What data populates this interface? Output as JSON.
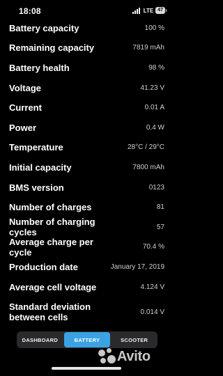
{
  "status_bar": {
    "time": "18:08",
    "network": "LTE",
    "battery_level": "47"
  },
  "rows": [
    {
      "label": "Battery capacity",
      "value": "100 %"
    },
    {
      "label": "Remaining capacity",
      "value": "7819 mAh"
    },
    {
      "label": "Battery health",
      "value": "98 %"
    },
    {
      "label": "Voltage",
      "value": "41.23 V"
    },
    {
      "label": "Current",
      "value": "0.01 A"
    },
    {
      "label": "Power",
      "value": "0.4 W"
    },
    {
      "label": "Temperature",
      "value": "28°C / 29°C"
    },
    {
      "label": "Initial capacity",
      "value": "7800 mAh"
    },
    {
      "label": "BMS version",
      "value": "0123"
    },
    {
      "label": "Number of charges",
      "value": "81"
    },
    {
      "label": "Number of charging cycles",
      "value": "57"
    },
    {
      "label": "Average charge per cycle",
      "value": "70.4 %"
    },
    {
      "label": "Production date",
      "value": "January 17, 2019"
    },
    {
      "label": "Average cell voltage",
      "value": "4.124 V"
    },
    {
      "label": "Standard deviation between cells",
      "value": "0.014 V"
    }
  ],
  "tabs": [
    {
      "label": "DASHBOARD",
      "active": false
    },
    {
      "label": "BATTERY",
      "active": true
    },
    {
      "label": "SCOOTER",
      "active": false
    }
  ],
  "watermark": {
    "text": "Avito"
  },
  "colors": {
    "background": "#000000",
    "tab_bar": "#2a2a2c",
    "tab_active": "#3aa2e3",
    "value_text": "#cfcfcf"
  }
}
